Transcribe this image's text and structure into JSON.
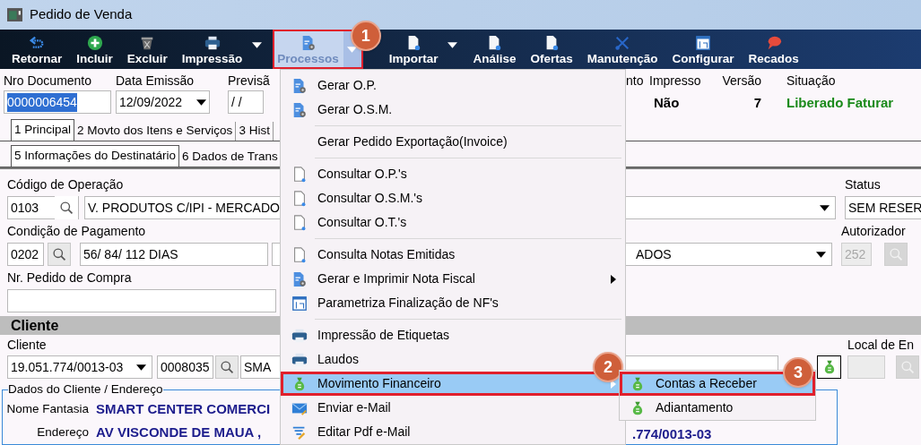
{
  "window": {
    "title": "Pedido de Venda"
  },
  "toolbar": [
    {
      "label": "Retornar",
      "selected": false,
      "dropdown": false
    },
    {
      "label": "Incluir",
      "selected": false,
      "dropdown": false
    },
    {
      "label": "Excluir",
      "selected": false,
      "dropdown": false
    },
    {
      "label": "Impressão",
      "selected": false,
      "dropdown": true
    },
    {
      "label": "Processos",
      "selected": true,
      "dropdown": true,
      "callout": "1"
    },
    {
      "label": "Importar",
      "selected": false,
      "dropdown": true
    },
    {
      "label": "Análise",
      "selected": false,
      "dropdown": false
    },
    {
      "label": "Ofertas",
      "selected": false,
      "dropdown": false
    },
    {
      "label": "Manutenção",
      "selected": false,
      "dropdown": false
    },
    {
      "label": "Configurar",
      "selected": false,
      "dropdown": false
    },
    {
      "label": "Recados",
      "selected": false,
      "dropdown": false
    }
  ],
  "header_fields": [
    {
      "label": "Nro Documento",
      "value": "0000006454",
      "kind": "selected-text"
    },
    {
      "label": "Data Emissão",
      "value": "12/09/2022",
      "kind": "date"
    },
    {
      "label": "Previsã",
      "value": "/  /",
      "kind": "text"
    }
  ],
  "header_info": [
    {
      "label": "nto"
    },
    {
      "label": "Impresso",
      "value": "Não",
      "kind": "plain"
    },
    {
      "label": "Versão",
      "value": "7",
      "kind": "number"
    },
    {
      "label": "Situação",
      "value": "Liberado Faturar",
      "kind": "status"
    }
  ],
  "tabs_row_1": [
    {
      "label": "1 Principal",
      "selected": true
    },
    {
      "label": "2 Movto dos Itens e Serviços",
      "selected": false
    },
    {
      "label": "3 Hist",
      "selected": false
    }
  ],
  "tabs_row_2": [
    {
      "label": "5 Informações do Destinatário",
      "selected": true
    },
    {
      "label": "6 Dados de Trans",
      "selected": false
    }
  ],
  "operacao": {
    "label": "Código de Operação",
    "code": "0103",
    "description": "V. PRODUTOS C/IPI - MERCADO"
  },
  "status": {
    "label": "Status",
    "value": "SEM RESER"
  },
  "pagamento": {
    "label": "Condição de Pagamento",
    "code": "0202",
    "description": "56/ 84/ 112 DIAS",
    "dropdown_text": "ADOS"
  },
  "autorizador": {
    "label": "Autorizador",
    "value": "252",
    "disabled": true
  },
  "pedido_compra": {
    "label": "Nr. Pedido de Compra"
  },
  "cliente_section": {
    "title": "Cliente"
  },
  "cliente": {
    "label": "Cliente",
    "cnpj": "19.051.774/0013-03",
    "code": "0008035",
    "name": "SMA"
  },
  "local_entrega": {
    "label": "Local de En",
    "disabled": true
  },
  "endereco": {
    "legend": "Dados do Cliente / Endereço",
    "rows": [
      {
        "label": "Nome Fantasia",
        "value": "SMART CENTER COMERCI"
      },
      {
        "label": "Endereço",
        "value": "AV VISCONDE DE MAUA ,",
        "extra": ".774/0013-03"
      }
    ]
  },
  "menu": {
    "items": [
      {
        "kind": "item",
        "label": "Gerar O.P.",
        "selected": false,
        "submenu": false
      },
      {
        "kind": "item",
        "label": "Gerar O.S.M.",
        "selected": false,
        "submenu": false
      },
      {
        "kind": "separator"
      },
      {
        "kind": "item",
        "label": "Gerar Pedido Exportação(Invoice)",
        "selected": false,
        "submenu": false
      },
      {
        "kind": "separator"
      },
      {
        "kind": "item",
        "label": "Consultar O.P.'s",
        "selected": false,
        "submenu": false
      },
      {
        "kind": "item",
        "label": "Consultar O.S.M.'s",
        "selected": false,
        "submenu": false
      },
      {
        "kind": "item",
        "label": "Consultar O.T.'s",
        "selected": false,
        "submenu": false
      },
      {
        "kind": "separator"
      },
      {
        "kind": "item",
        "label": "Consulta Notas Emitidas",
        "selected": false,
        "submenu": false
      },
      {
        "kind": "item",
        "label": "Gerar e Imprimir Nota Fiscal",
        "selected": false,
        "submenu": true
      },
      {
        "kind": "item",
        "label": "Parametriza Finalização de NF's",
        "selected": false,
        "submenu": false
      },
      {
        "kind": "separator"
      },
      {
        "kind": "item",
        "label": "Impressão de Etiquetas",
        "selected": false,
        "submenu": false
      },
      {
        "kind": "item",
        "label": "Laudos",
        "selected": false,
        "submenu": false
      },
      {
        "kind": "item",
        "label": "Movimento Financeiro",
        "selected": true,
        "submenu": true,
        "callout": "2"
      },
      {
        "kind": "item",
        "label": "Enviar e-Mail",
        "selected": false,
        "submenu": false
      },
      {
        "kind": "item",
        "label": "Editar Pdf e-Mail",
        "selected": false,
        "submenu": false
      }
    ]
  },
  "submenu": {
    "items": [
      {
        "label": "Contas a Receber",
        "selected": true,
        "callout": "3"
      },
      {
        "label": "Adiantamento",
        "selected": false
      }
    ]
  }
}
